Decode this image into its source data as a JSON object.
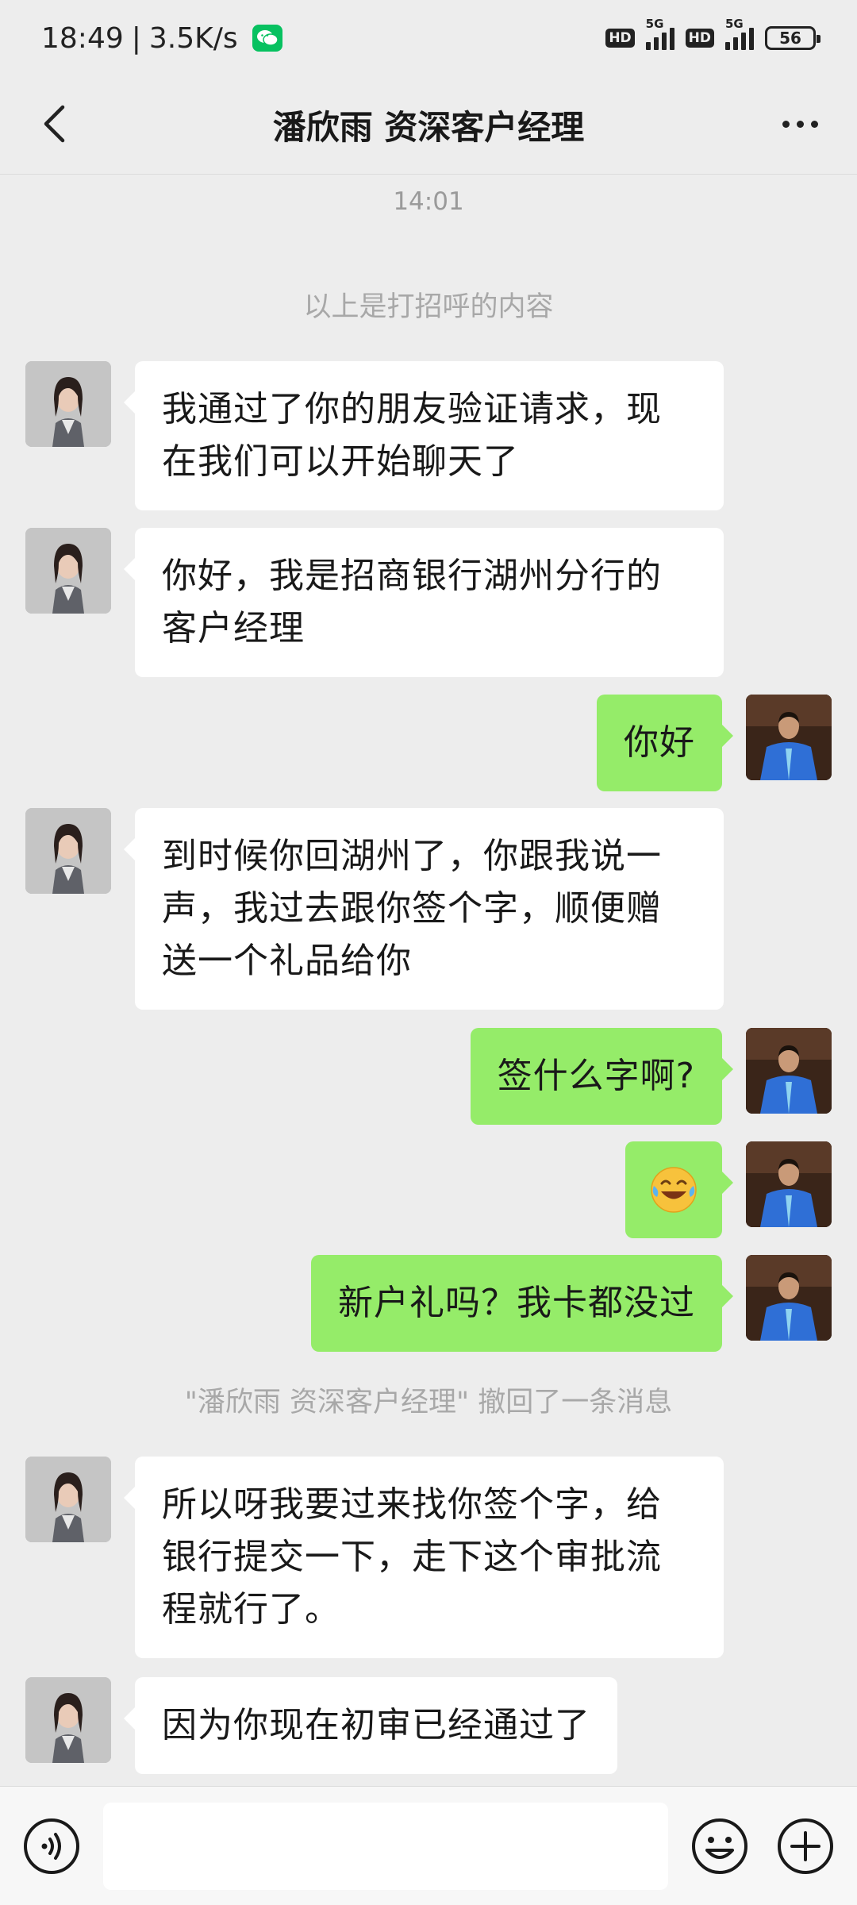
{
  "status_bar": {
    "time": "18:49",
    "network_speed": "3.5K/s",
    "app_icon": "wechat-icon",
    "hd1": "HD",
    "net1": "5G",
    "hd2": "HD",
    "net2": "5G",
    "battery": "56"
  },
  "header": {
    "title": "潘欣雨 资深客户经理",
    "back_icon": "chevron-left-icon",
    "more_icon": "more-icon"
  },
  "chat": {
    "timestamp": "14:01",
    "greeting_note": "以上是打招呼的内容",
    "messages": [
      {
        "side": "in",
        "text": "我通过了你的朋友验证请求，现在我们可以开始聊天了"
      },
      {
        "side": "in",
        "text": "你好，我是招商银行湖州分行的客户经理"
      },
      {
        "side": "out",
        "text": "你好"
      },
      {
        "side": "in",
        "text": "到时候你回湖州了，你跟我说一声，我过去跟你签个字，顺便赠送一个礼品给你"
      },
      {
        "side": "out",
        "text": "签什么字啊?"
      },
      {
        "side": "out",
        "text": "😂",
        "emoji": "face-with-tears-of-joy"
      },
      {
        "side": "out",
        "text": "新户礼吗？我卡都没过"
      },
      {
        "side": "in",
        "text": "所以呀我要过来找你签个字，给银行提交一下，走下这个审批流程就行了。"
      },
      {
        "side": "in",
        "text": "因为你现在初审已经通过了"
      }
    ],
    "recall_note": "\"潘欣雨 资深客户经理\" 撤回了一条消息"
  },
  "input_bar": {
    "voice_icon": "voice-icon",
    "emoji_icon": "emoji-icon",
    "plus_icon": "plus-icon",
    "placeholder": ""
  },
  "colors": {
    "background": "#ededed",
    "incoming_bubble": "#ffffff",
    "outgoing_bubble": "#95ec69",
    "wechat_green": "#07c160"
  }
}
